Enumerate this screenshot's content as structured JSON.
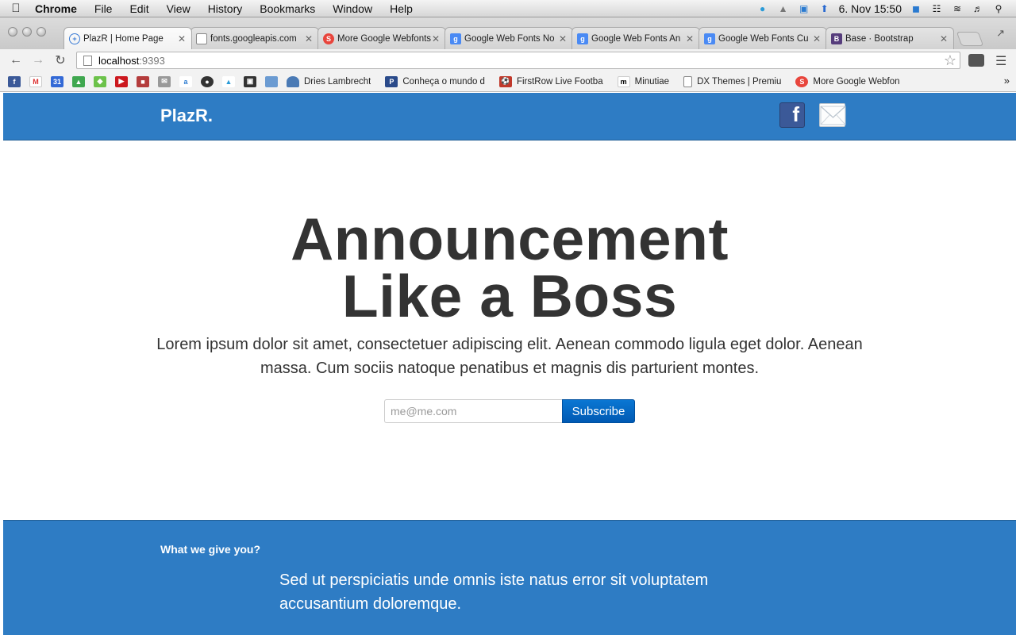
{
  "menubar": {
    "app_name": "Chrome",
    "items": [
      "File",
      "Edit",
      "View",
      "History",
      "Bookmarks",
      "Window",
      "Help"
    ],
    "clock": "6. Nov  15:50"
  },
  "tabs": [
    {
      "title": "PlazR | Home Page",
      "icon": "globe-icon",
      "color": "#3a7bd5",
      "active": true
    },
    {
      "title": "fonts.googleapis.com",
      "icon": "page-icon",
      "color": "#ffffff",
      "active": false
    },
    {
      "title": "More Google Webfonts",
      "icon": "red-circle-icon",
      "color": "#e8453c",
      "active": false
    },
    {
      "title": "Google Web Fonts No",
      "icon": "google-icon",
      "color": "#4a8af4",
      "active": false
    },
    {
      "title": "Google Web Fonts An",
      "icon": "google-icon",
      "color": "#4a8af4",
      "active": false
    },
    {
      "title": "Google Web Fonts Cu",
      "icon": "google-icon",
      "color": "#4a8af4",
      "active": false
    },
    {
      "title": "Base · Bootstrap",
      "icon": "bootstrap-icon",
      "color": "#563d7c",
      "active": false
    }
  ],
  "omnibox": {
    "host": "localhost",
    "port": ":9393"
  },
  "bookmarks": [
    {
      "label": "Dries Lambrecht",
      "icon": "person-icon",
      "color": "#4a7ab5"
    },
    {
      "label": "Conheça o mundo d",
      "icon": "p-icon",
      "color": "#2a4a8a"
    },
    {
      "label": "FirstRow Live Footba",
      "icon": "football-icon",
      "color": "#c0392b"
    },
    {
      "label": "Minutiae",
      "icon": "m-icon",
      "color": "#ffffff"
    },
    {
      "label": "DX Themes | Premiu",
      "icon": "page-icon",
      "color": "#ffffff"
    },
    {
      "label": "More Google Webfon",
      "icon": "red-circle-icon",
      "color": "#e8453c"
    }
  ],
  "site": {
    "brand": "PlazR.",
    "headline_line1": "Announcement",
    "headline_line2": "Like a Boss",
    "tagline": "Lorem ipsum dolor sit amet, consectetuer adipiscing elit. Aenean commodo ligula eget dolor. Aenean massa. Cum sociis natoque penatibus et magnis dis parturient montes.",
    "email_placeholder": "me@me.com",
    "subscribe_label": "Subscribe",
    "facebook_letter": "f",
    "features_heading": "What we give you?",
    "features_text": "Sed ut perspiciatis unde omnis iste natus error sit voluptatem accusantium doloremque."
  },
  "colors": {
    "header_blue": "#2e7cc4",
    "button_blue": "#0a77d3",
    "headline": "#333333"
  }
}
